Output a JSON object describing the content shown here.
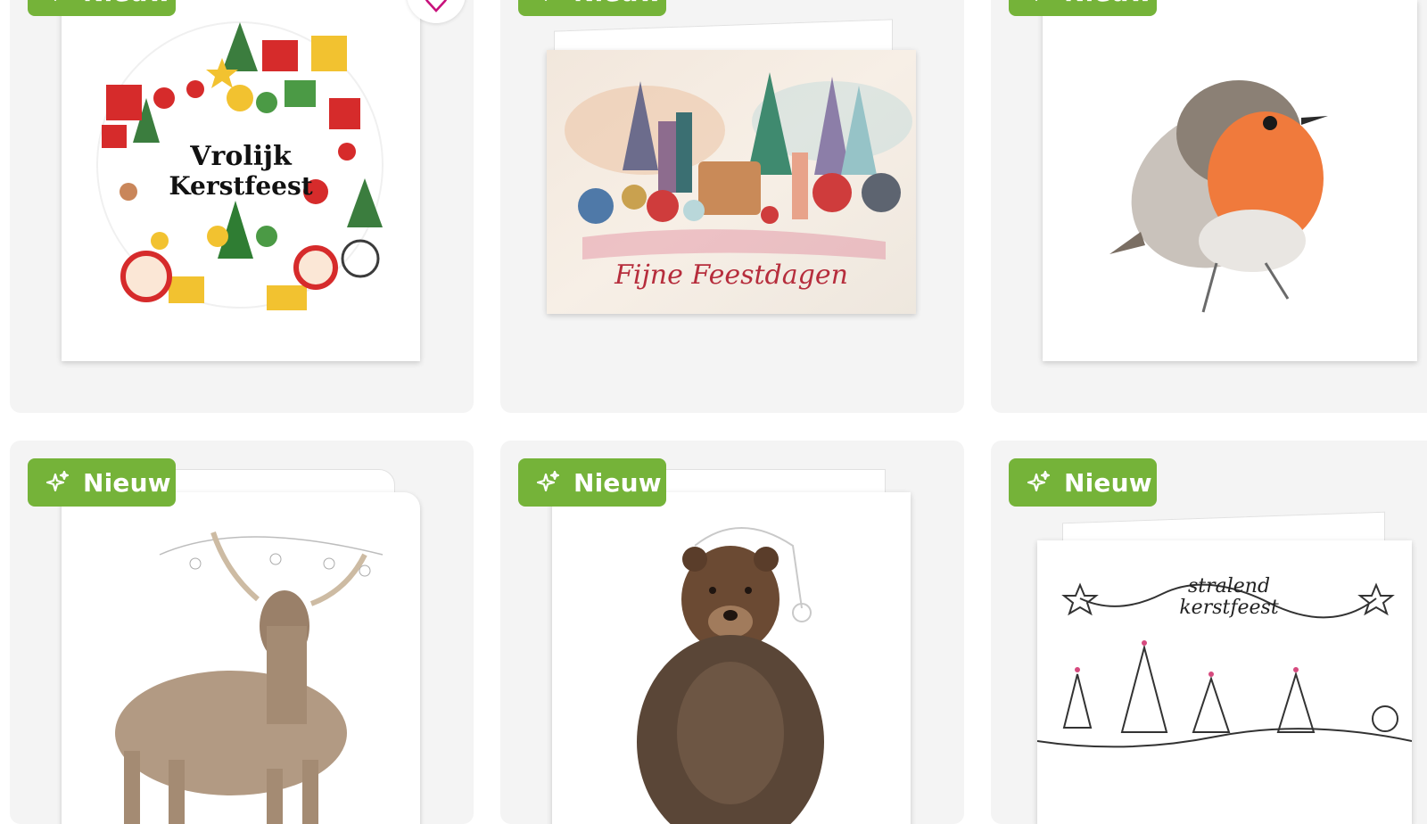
{
  "badge_label": "Nieuw",
  "colors": {
    "badge_green": "#75b339",
    "tile_bg": "#f4f4f4",
    "heart_pink": "#c8127c"
  },
  "icons": {
    "badge": "sparkle-icon",
    "favorite": "heart-icon"
  },
  "cards": [
    {
      "greeting_line1": "Vrolijk",
      "greeting_line2": "Kerstfeest"
    },
    {
      "greeting": "Fijne Feestdagen"
    },
    {},
    {},
    {},
    {
      "greeting_line1": "stralend",
      "greeting_line2": "kerstfeest"
    }
  ]
}
